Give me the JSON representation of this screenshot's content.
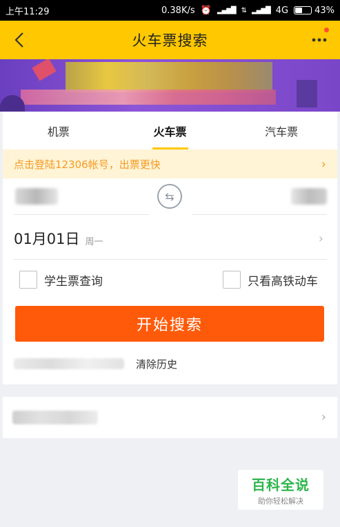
{
  "status_bar": {
    "time": "上午11:29",
    "speed": "0.38K/s",
    "network": "4G",
    "battery": "43%",
    "battery_level": 0.43
  },
  "nav": {
    "title": "火车票搜索"
  },
  "tabs": [
    {
      "label": "机票",
      "active": false
    },
    {
      "label": "火车票",
      "active": true
    },
    {
      "label": "汽车票",
      "active": false
    }
  ],
  "login_tip": {
    "text": "点击登陆12306帐号，出票更快"
  },
  "search": {
    "date": "01月01日",
    "weekday": "周一",
    "student_label": "学生票查询",
    "highspeed_label": "只看高铁动车",
    "button_label": "开始搜索",
    "clear_history": "清除历史"
  },
  "watermark": {
    "main": "百科全说",
    "sub": "助你轻松解决"
  },
  "colors": {
    "brand": "#ffc800",
    "accent": "#ff5a0a",
    "tip_text": "#f59a23",
    "tip_bg": "#fff4d6"
  },
  "icons": [
    "back-icon",
    "more-icon",
    "swap-icon",
    "chevron-right-icon",
    "checkbox-icon"
  ]
}
